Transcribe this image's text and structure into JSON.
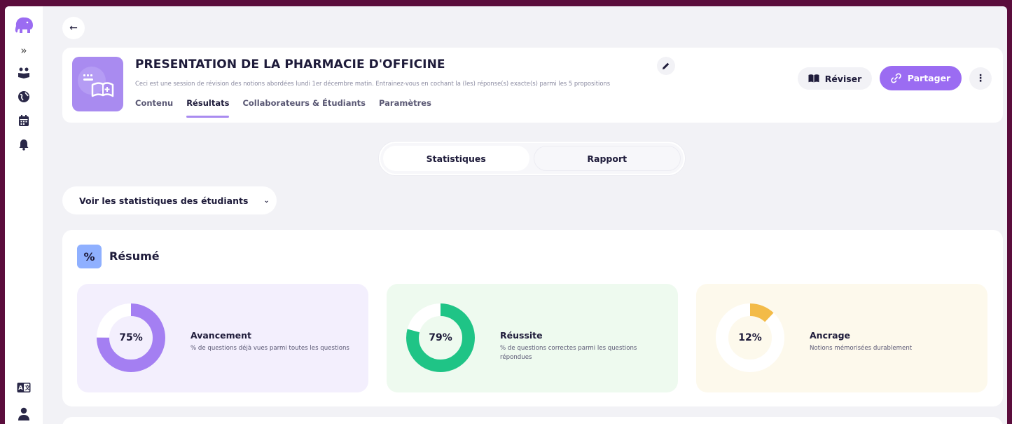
{
  "sidebar": {
    "expand_glyph": "»",
    "icons": [
      "elephant-logo-icon",
      "expand-icon",
      "students-icon",
      "globe-icon",
      "calendar-icon",
      "bell-icon",
      "language-icon",
      "user-icon"
    ]
  },
  "header": {
    "back_glyph": "←",
    "title": "PRESENTATION DE LA PHARMACIE D'OFFICINE",
    "description": "Ceci est une session de révision des notions abordées lundi 1er décembre matin. Entrainez-vous en cochant la (les) réponse(s) exacte(s) parmi les 5 propositions",
    "tabs": [
      {
        "label": "Contenu",
        "active": false
      },
      {
        "label": "Résultats",
        "active": true
      },
      {
        "label": "Collaborateurs & Étudiants",
        "active": false
      },
      {
        "label": "Paramètres",
        "active": false
      }
    ],
    "reviser_label": "Réviser",
    "partager_label": "Partager",
    "more_glyph": "⋮"
  },
  "view_toggle": {
    "options": [
      "Statistiques",
      "Rapport"
    ],
    "selected": "Statistiques"
  },
  "student_dropdown": {
    "label": "Voir les statistiques des étudiants",
    "chevron": "⌄"
  },
  "summary": {
    "badge": "%",
    "title": "Résumé",
    "stats": [
      {
        "value": 75,
        "display": "75%",
        "label": "Avancement",
        "description": "% de questions déjà vues parmi toutes les questions",
        "color": "#a47ff2",
        "track": "#ffffff",
        "bg": "#f3effd"
      },
      {
        "value": 79,
        "display": "79%",
        "label": "Réussite",
        "description": "% de questions correctes parmi les questions répondues",
        "color": "#1fc486",
        "track": "#ffffff",
        "bg": "#eefaef"
      },
      {
        "value": 12,
        "display": "12%",
        "label": "Ancrage",
        "description": "Notions mémorisées durablement",
        "color": "#f3bb48",
        "track": "#ffffff",
        "bg": "#fdf9ec"
      }
    ]
  },
  "colors": {
    "accent": "#9b6cf2",
    "outer_frame": "#5b0d3c",
    "page_bg": "#f2f2f6"
  }
}
